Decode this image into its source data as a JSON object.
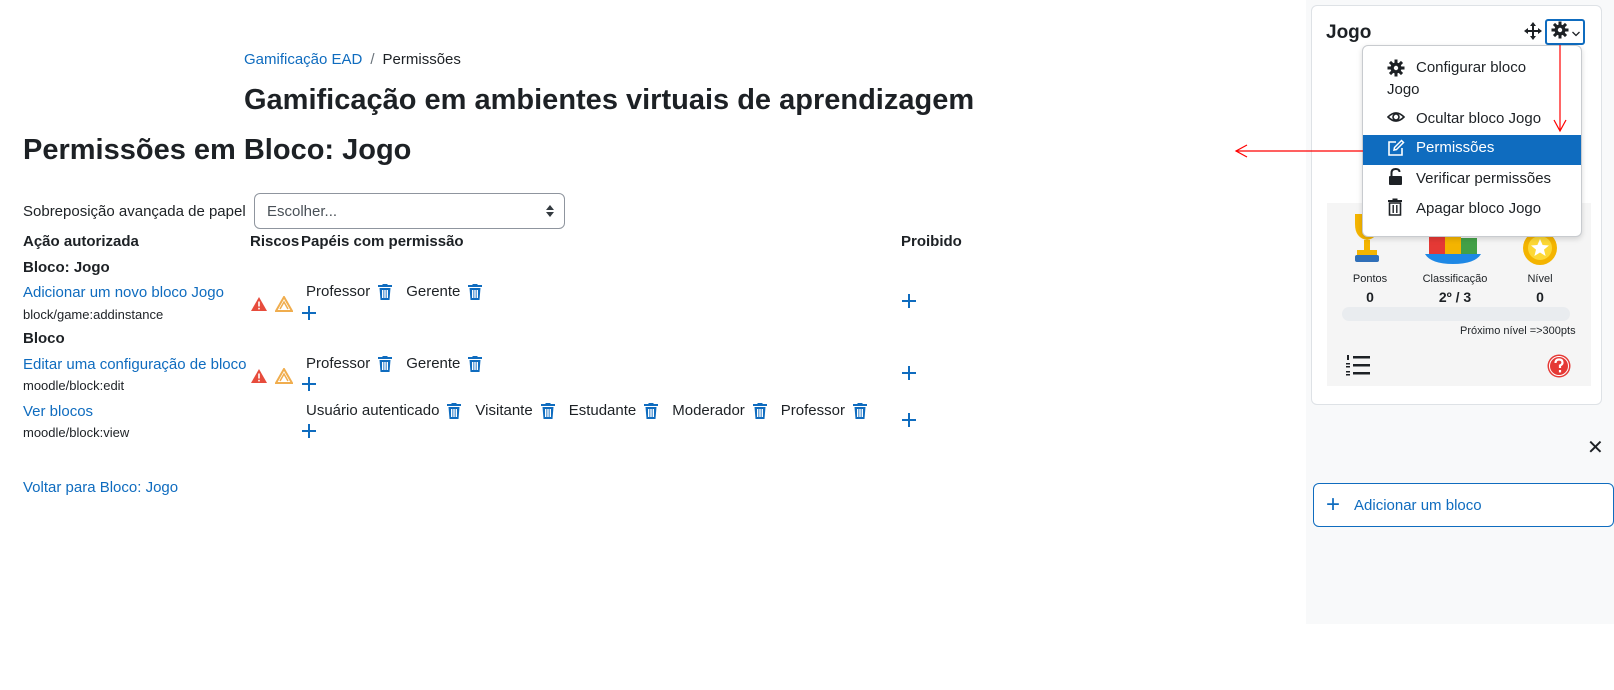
{
  "breadcrumb": {
    "items": [
      "Gamificação EAD",
      "Permissões"
    ],
    "separator": "/"
  },
  "course_title": "Gamificação em ambientes virtuais de aprendizagem",
  "page_title": "Permissões em Bloco: Jogo",
  "override": {
    "label": "Sobreposição avançada de papel",
    "value": "Escolher..."
  },
  "table": {
    "headers": [
      "Ação autorizada",
      "Riscos",
      "Papéis com permissão",
      "Proibido"
    ],
    "groups": [
      "Bloco: Jogo",
      "Bloco"
    ],
    "rows": [
      {
        "action": "Adicionar um novo bloco Jogo",
        "capability": "block/game:addinstance",
        "roles": [
          "Professor",
          "Gerente"
        ]
      },
      {
        "action": "Editar uma configuração de bloco",
        "capability": "moodle/block:edit",
        "roles": [
          "Professor",
          "Gerente"
        ]
      },
      {
        "action": "Ver blocos",
        "capability": "moodle/block:view",
        "roles": [
          "Usuário autenticado",
          "Visitante",
          "Estudante",
          "Moderador",
          "Professor"
        ]
      }
    ]
  },
  "back_link": "Voltar para Bloco: Jogo",
  "block": {
    "title": "Jogo",
    "menu": [
      {
        "label": "Configurar bloco",
        "label2": "Jogo",
        "icon": "gear-icon"
      },
      {
        "label": "Ocultar bloco Jogo",
        "icon": "eye-icon"
      },
      {
        "label": "Permissões",
        "icon": "pen-square-icon"
      },
      {
        "label": "Verificar permissões",
        "icon": "unlock-icon"
      },
      {
        "label": "Apagar bloco Jogo",
        "icon": "trash-icon"
      }
    ],
    "stats": {
      "points_label": "Pontos",
      "points_value": "0",
      "rank_label": "Classificação",
      "rank_value": "2º / 3",
      "level_label": "Nível",
      "level_value": "0"
    },
    "progress": 0,
    "next_level": "Próximo nível =>300pts"
  },
  "close_label": "✕",
  "add_block": "Adicionar um bloco",
  "colors": {
    "link": "#0f6cbf",
    "risk_red": "#e74c3c",
    "risk_orange": "#f0ad4e",
    "annotation": "#ff0000"
  }
}
